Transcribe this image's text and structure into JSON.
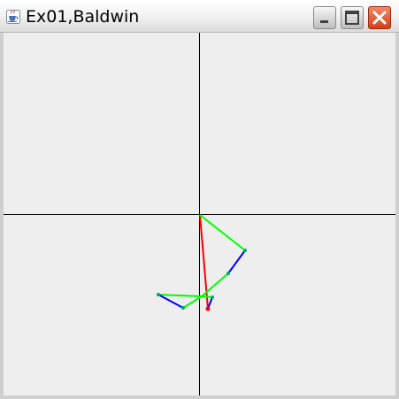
{
  "window": {
    "title": "Ex01,Baldwin",
    "app_icon": "java-cup-icon",
    "controls": {
      "minimize_icon": "minimize-icon",
      "maximize_icon": "maximize-icon",
      "close_icon": "close-icon"
    }
  },
  "colors": {
    "axes": "#000000",
    "red_segment": "#ff0000",
    "green_segment": "#00ff00",
    "blue_segment": "#0000ff",
    "background": "#eeeeee"
  }
}
